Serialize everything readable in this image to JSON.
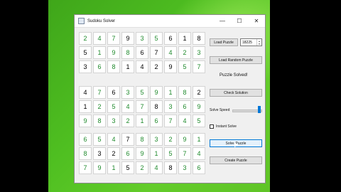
{
  "window": {
    "title": "Sudoku Solver",
    "controls": {
      "minimize": "—",
      "maximize": "☐",
      "close": "✕"
    }
  },
  "board": {
    "rows": [
      [
        "2",
        "4",
        "7",
        "9",
        "3",
        "5",
        "6",
        "1",
        "8"
      ],
      [
        "5",
        "1",
        "9",
        "8",
        "6",
        "7",
        "4",
        "2",
        "3"
      ],
      [
        "3",
        "6",
        "8",
        "1",
        "4",
        "2",
        "9",
        "5",
        "7"
      ],
      [
        "4",
        "7",
        "6",
        "3",
        "5",
        "9",
        "1",
        "8",
        "2"
      ],
      [
        "1",
        "2",
        "5",
        "4",
        "7",
        "8",
        "3",
        "6",
        "9"
      ],
      [
        "9",
        "8",
        "3",
        "2",
        "1",
        "6",
        "7",
        "4",
        "5"
      ],
      [
        "6",
        "5",
        "4",
        "7",
        "8",
        "3",
        "2",
        "9",
        "1"
      ],
      [
        "8",
        "3",
        "2",
        "6",
        "9",
        "1",
        "5",
        "7",
        "4"
      ],
      [
        "7",
        "9",
        "1",
        "5",
        "2",
        "4",
        "8",
        "3",
        "6"
      ]
    ],
    "solved_mask": [
      [
        1,
        1,
        1,
        0,
        1,
        1,
        0,
        0,
        0
      ],
      [
        0,
        1,
        1,
        1,
        0,
        0,
        1,
        1,
        1
      ],
      [
        0,
        1,
        1,
        0,
        0,
        0,
        0,
        1,
        1
      ],
      [
        0,
        1,
        0,
        1,
        1,
        1,
        1,
        1,
        0
      ],
      [
        0,
        1,
        1,
        1,
        1,
        0,
        1,
        1,
        1
      ],
      [
        1,
        1,
        1,
        1,
        1,
        1,
        1,
        1,
        1
      ],
      [
        1,
        1,
        1,
        0,
        1,
        1,
        1,
        1,
        1
      ],
      [
        1,
        0,
        0,
        1,
        1,
        1,
        1,
        1,
        1
      ],
      [
        1,
        1,
        1,
        0,
        1,
        1,
        0,
        1,
        1
      ]
    ],
    "colors": {
      "given": "#000000",
      "solved": "#1f8a2c"
    }
  },
  "panel": {
    "load_puzzle_label": "Load Puzzle",
    "puzzle_number": "18225",
    "load_random_label": "Load Random Puzzle",
    "status_text": "Puzzle Solved!",
    "check_solution_label": "Check Solution",
    "solve_speed_label": "Solve Speed",
    "solve_speed_value": 1.0,
    "instant_solve_label": "Instant Solve",
    "instant_solve_checked": false,
    "solve_puzzle_label": "Solve Puzzle",
    "create_puzzle_label": "Create Puzzle"
  },
  "accent": "#0078d7"
}
